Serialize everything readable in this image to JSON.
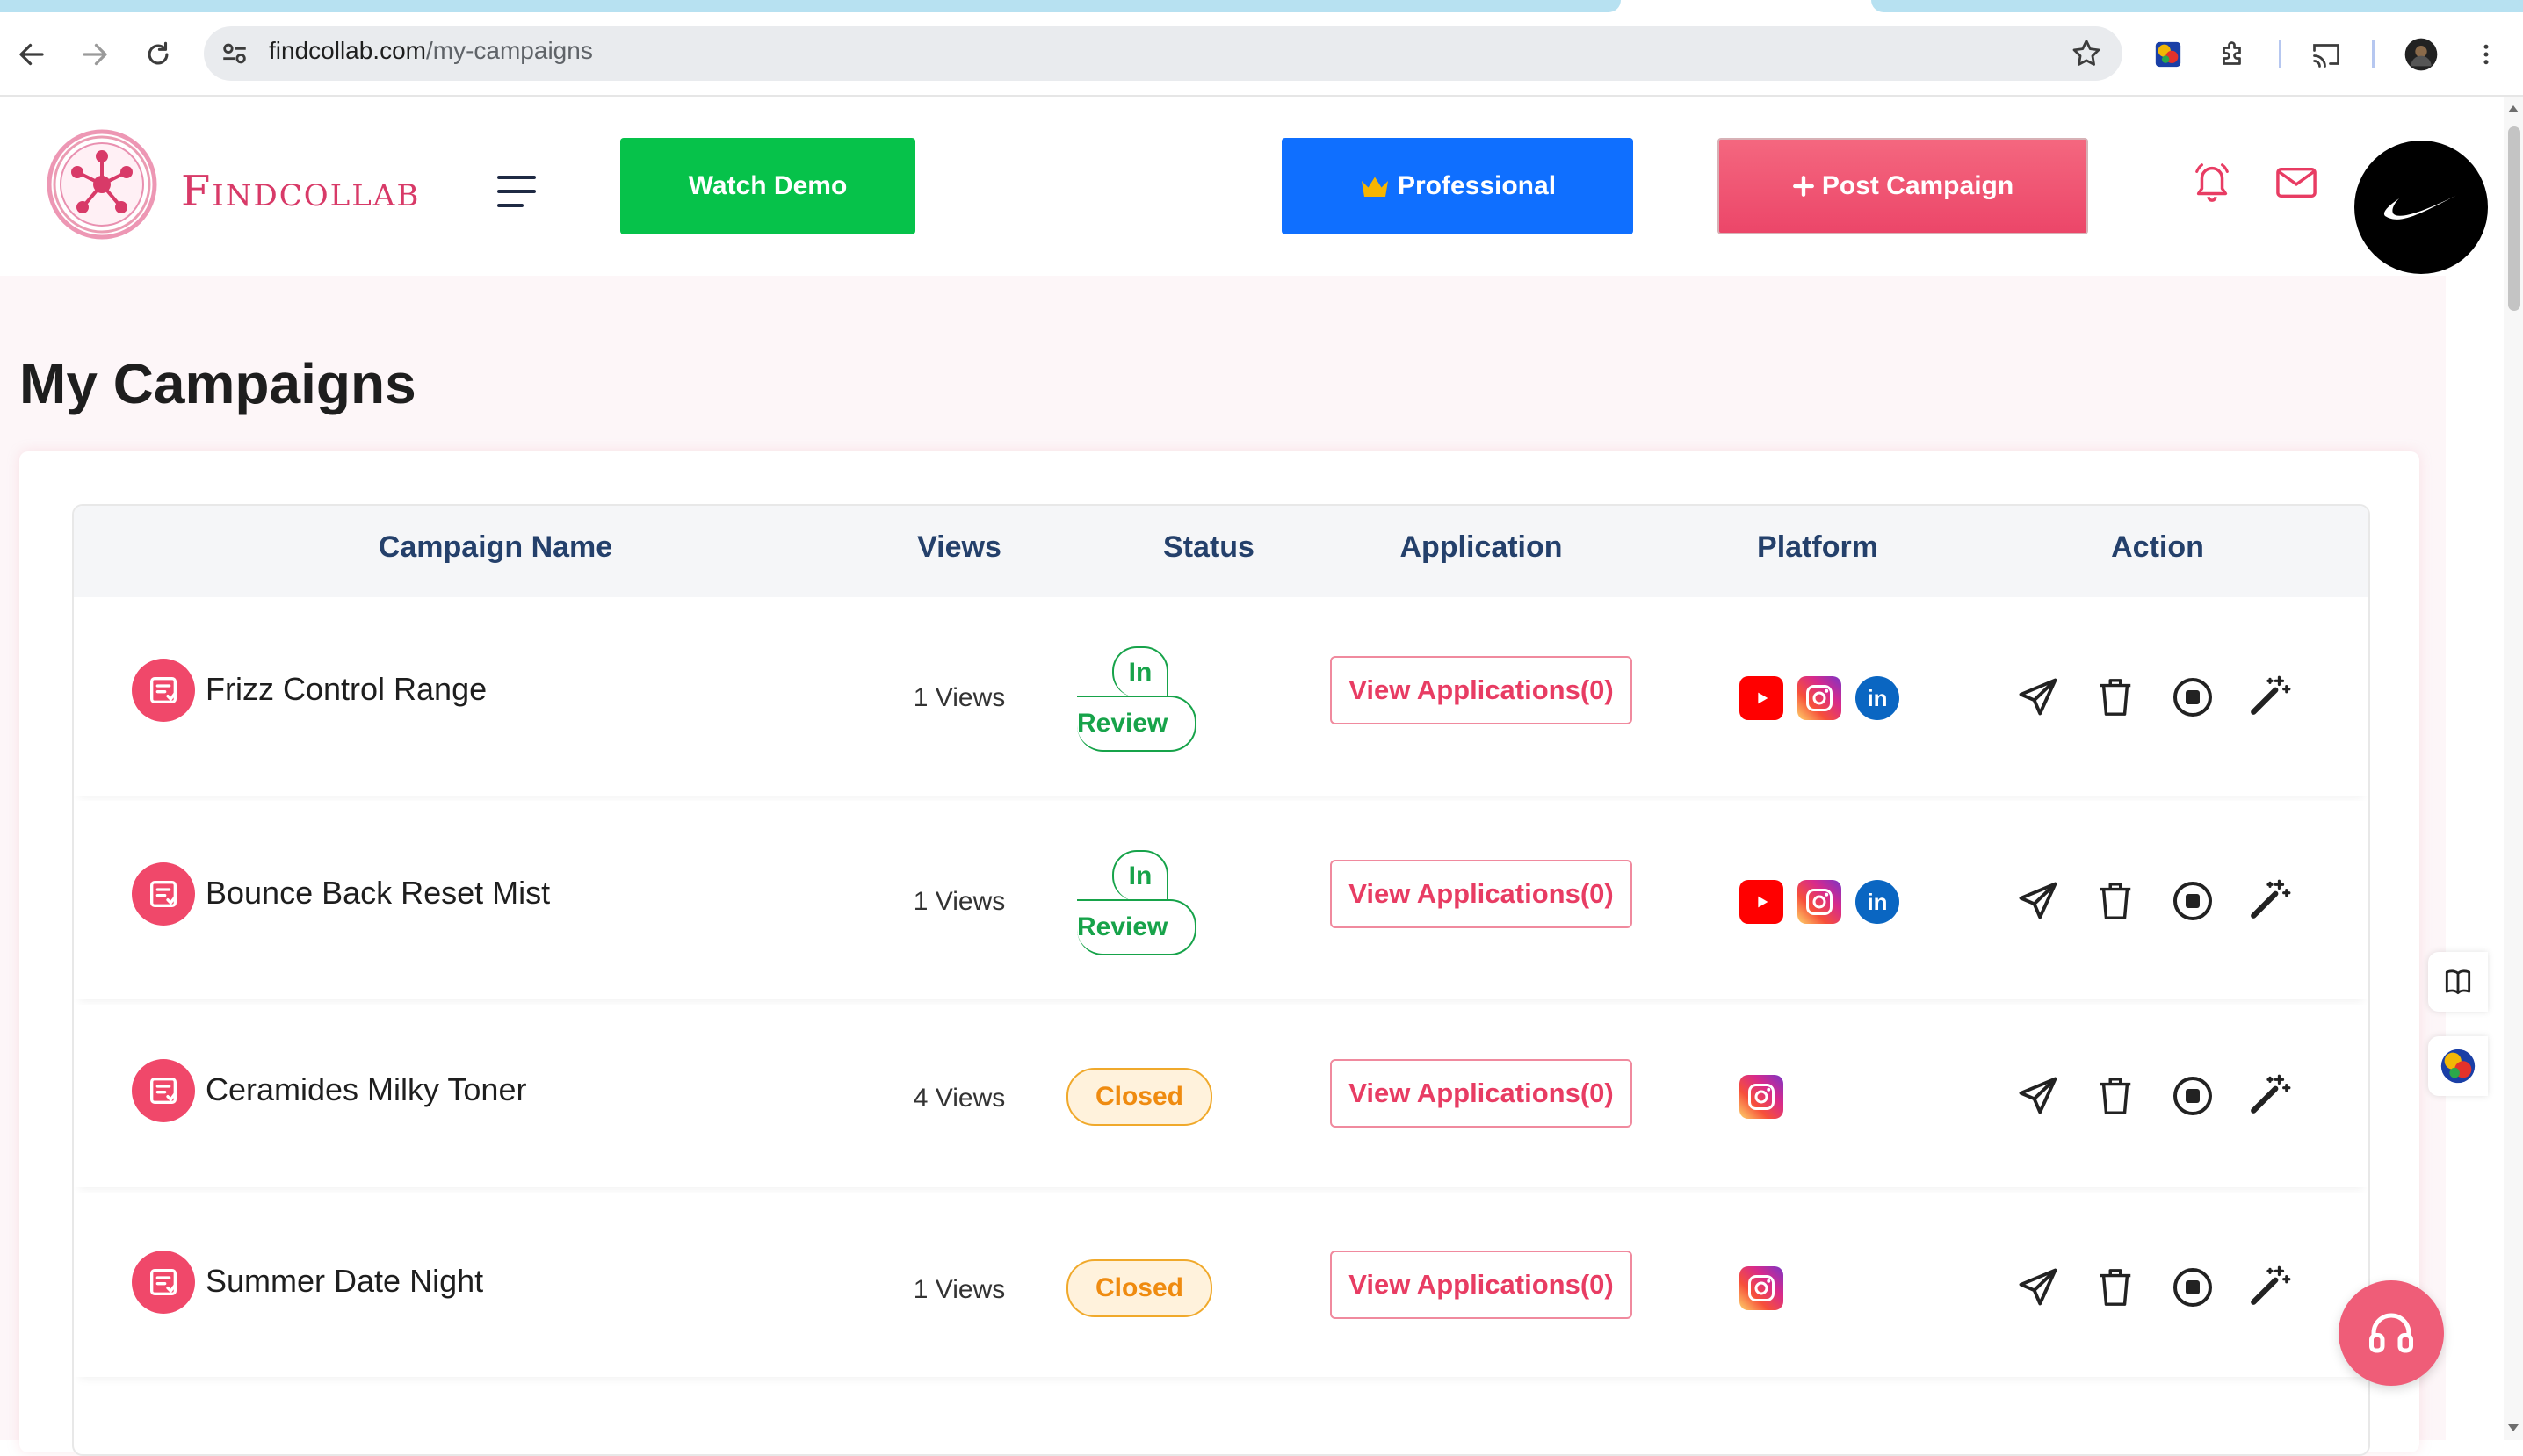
{
  "browser": {
    "url_host": "findcollab.com",
    "url_path": "/my-campaigns"
  },
  "header": {
    "logo_text": "Findcollab",
    "watch_demo": "Watch Demo",
    "professional": "Professional",
    "post_campaign": "Post Campaign"
  },
  "page": {
    "title": "My Campaigns"
  },
  "table": {
    "columns": [
      "Campaign Name",
      "Views",
      "Status",
      "Application",
      "Platform",
      "Action"
    ],
    "rows": [
      {
        "name": "Frizz Control Range",
        "views": "1 Views",
        "status_line1": "In",
        "status_line2": "Review",
        "status": "In Review",
        "application": "View Applications(0)",
        "platforms": [
          "youtube",
          "instagram",
          "linkedin"
        ]
      },
      {
        "name": "Bounce Back Reset Mist",
        "views": "1 Views",
        "status_line1": "In",
        "status_line2": "Review",
        "status": "In Review",
        "application": "View Applications(0)",
        "platforms": [
          "youtube",
          "instagram",
          "linkedin"
        ]
      },
      {
        "name": "Ceramides Milky Toner",
        "views": "4 Views",
        "status": "Closed",
        "application": "View Applications(0)",
        "platforms": [
          "instagram"
        ]
      },
      {
        "name": "Summer Date Night",
        "views": "1 Views",
        "status": "Closed",
        "application": "View Applications(0)",
        "platforms": [
          "instagram"
        ]
      }
    ],
    "actions": [
      "send-icon",
      "trash-icon",
      "stop-icon",
      "magic-wand-icon"
    ]
  },
  "colors": {
    "brand": "#d83a68",
    "demo_green": "#06c24a",
    "pro_blue": "#0f6fff",
    "post_pink": "#ec4669",
    "review_green": "#17a34a",
    "closed_orange": "#ef8b10",
    "header_text": "#24406b"
  }
}
